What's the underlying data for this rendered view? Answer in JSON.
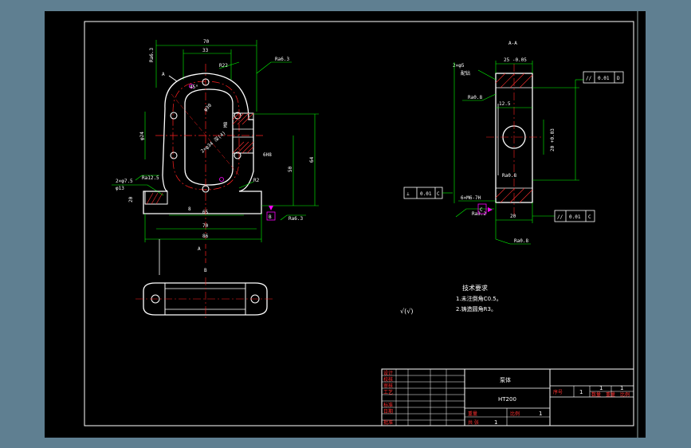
{
  "section_label": "A-A",
  "view_marks": {
    "a_top": "A",
    "a_bottom": "A",
    "b": "B",
    "b_lower": "B"
  },
  "front_view": {
    "dims": {
      "top70": "70",
      "top33": "33",
      "r22": "R22",
      "deg45": "45°",
      "phi30": "φ30",
      "phi24": "φ24",
      "hole_spec": "2×φ34 深(4)",
      "d50": "50",
      "d64": "64",
      "b65": "65",
      "b70": "70",
      "b86": "86",
      "d8": "8",
      "d20": "20",
      "r2": "R2",
      "m8": "M8",
      "spec_left": "2×φ7.5",
      "spec_left2": "φ13",
      "thread": "6H8"
    },
    "roughness": {
      "r1": "Ra6.3",
      "r2": "Ra6.3",
      "r3": "Ra12.5",
      "r4": "Ra6.3"
    },
    "datum": "B"
  },
  "section_view": {
    "dims": {
      "top_tol": "25 -0.05",
      "d12_5": "12.5",
      "dia_tol": "20 +0.03",
      "d20": "20",
      "hole_note": "2×φ5",
      "hole_note2": "配钻",
      "thread": "6×M6-7H"
    },
    "roughness": {
      "r1": "Ra0.8",
      "r2": "Ra0.8",
      "r3": "Ra3.2",
      "r4": "Ra0.8"
    },
    "tolerances": {
      "parallel_top": {
        "symbol": "//",
        "value": "0.01",
        "datum": "D"
      },
      "perp_left": {
        "symbol": "⊥",
        "value": "0.01",
        "datum": "C"
      },
      "parallel_bottom": {
        "symbol": "//",
        "value": "0.01",
        "datum": "C"
      }
    },
    "datum": "C"
  },
  "tech_requirements": {
    "title": "技术要求",
    "items": [
      "1.未注倒角C0.5。",
      "2.铸造圆角R3。"
    ],
    "rough_mark": "√(√)"
  },
  "title_block": {
    "part_name": "泵体",
    "material": "HT200",
    "seq_label": "序号",
    "seq_value": "1",
    "count1": "1",
    "count2": "1",
    "weight_label": "重量",
    "scale_label": "比例",
    "scale_value": "1",
    "sheet_label": "共  张",
    "sheet_value": "1",
    "left_labels": [
      "设计",
      "校核",
      "审核",
      "工艺",
      "标准",
      "日期",
      "批准"
    ],
    "right_sub": [
      "数量",
      "重量",
      "比例"
    ]
  },
  "colors": {
    "bg": "#5f7f91",
    "sheet": "#000000",
    "line": "#ffffff",
    "dim": "#00ff00",
    "center": "#ff2020",
    "magenta": "#ff00ff",
    "hatch": "#ff3030"
  }
}
